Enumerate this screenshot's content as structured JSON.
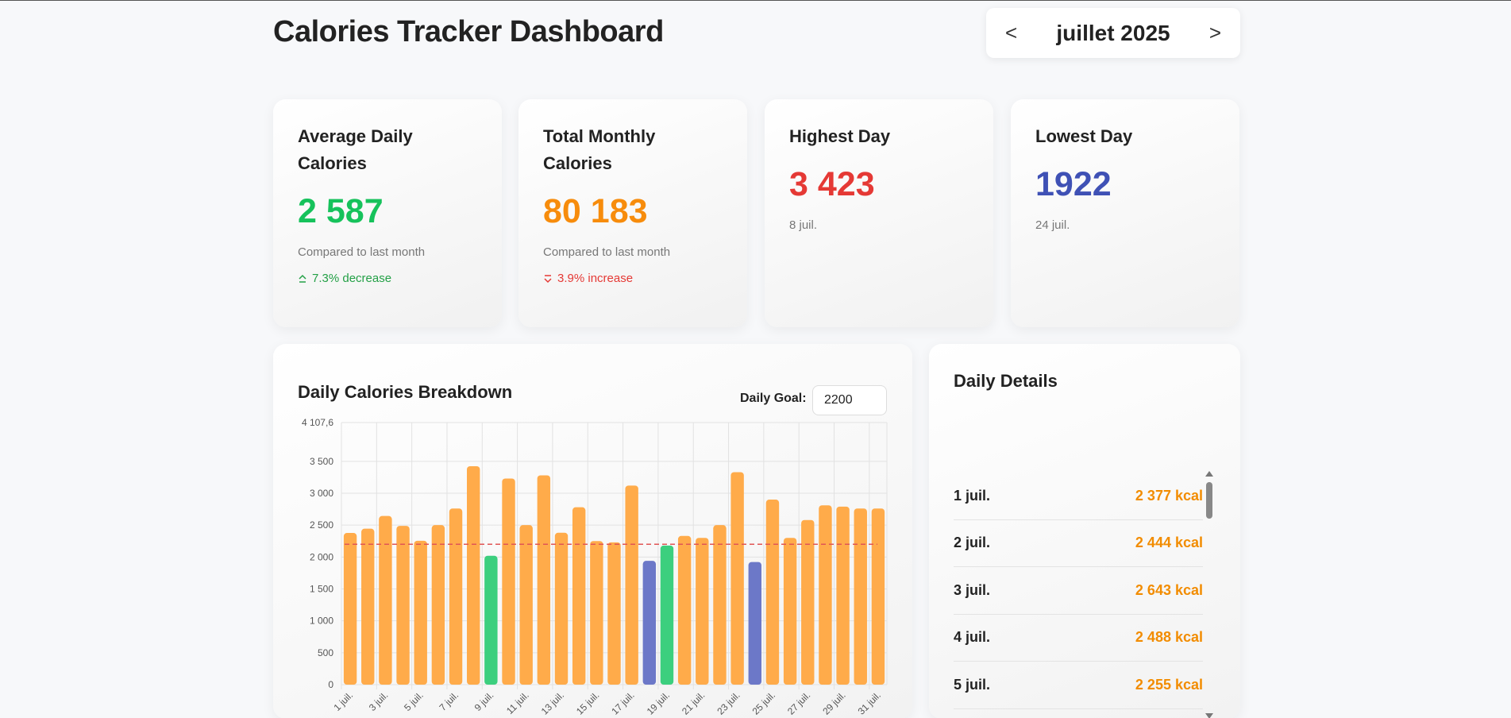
{
  "header": {
    "title": "Calories Tracker Dashboard"
  },
  "month_picker": {
    "prev": "<",
    "label": "juillet 2025",
    "next": ">"
  },
  "cards": [
    {
      "title": "Average Daily Calories",
      "value": "2 587",
      "value_color": "#16c25b",
      "sub": "Compared to last month",
      "change": "7.3% decrease",
      "change_color": "#23a046"
    },
    {
      "title": "Total Monthly Calories",
      "value": "80 183",
      "value_color": "#f78c0c",
      "sub": "Compared to last month",
      "change": "3.9% increase",
      "change_color": "#e53935"
    },
    {
      "title": "Highest Day",
      "value": "3 423",
      "value_color": "#e53935",
      "sub": "8 juil."
    },
    {
      "title": "Lowest Day",
      "value": "1922",
      "value_color": "#3f51b5",
      "sub": "24 juil."
    }
  ],
  "chart_panel": {
    "title": "Daily Calories Breakdown",
    "goal_label": "Daily Goal:",
    "goal_value": "2200"
  },
  "chart_data": {
    "type": "bar",
    "categories": [
      "1 juil.",
      "2 juil.",
      "3 juil.",
      "4 juil.",
      "5 juil.",
      "6 juil.",
      "7 juil.",
      "8 juil.",
      "9 juil.",
      "10 juil.",
      "11 juil.",
      "12 juil.",
      "13 juil.",
      "14 juil.",
      "15 juil.",
      "16 juil.",
      "17 juil.",
      "18 juil.",
      "19 juil.",
      "20 juil.",
      "21 juil.",
      "22 juil.",
      "23 juil.",
      "24 juil.",
      "25 juil.",
      "26 juil.",
      "27 juil.",
      "28 juil.",
      "29 juil.",
      "30 juil.",
      "31 juil."
    ],
    "x_tick_labels": [
      "1 juil.",
      "3 juil.",
      "5 juil.",
      "7 juil.",
      "9 juil.",
      "11 juil.",
      "13 juil.",
      "15 juil.",
      "17 juil.",
      "19 juil.",
      "21 juil.",
      "23 juil.",
      "25 juil.",
      "27 juil.",
      "29 juil.",
      "31 juil."
    ],
    "values": [
      2377,
      2444,
      2643,
      2488,
      2255,
      2500,
      2760,
      3423,
      2020,
      3230,
      2500,
      3280,
      2380,
      2780,
      2250,
      2230,
      3120,
      1940,
      2180,
      2330,
      2300,
      2500,
      3330,
      1922,
      2900,
      2300,
      2580,
      2810,
      2790,
      2760,
      2760
    ],
    "bar_colors": [
      "over",
      "over",
      "over",
      "over",
      "over",
      "over",
      "over",
      "over",
      "under",
      "over",
      "over",
      "over",
      "over",
      "over",
      "over",
      "over",
      "over",
      "low",
      "under",
      "over",
      "over",
      "over",
      "over",
      "low",
      "over",
      "over",
      "over",
      "over",
      "over",
      "over",
      "over"
    ],
    "palette": {
      "over": "#ffab4a",
      "under": "#3ccf7e",
      "low": "#6c78c8",
      "goal": "#e05555"
    },
    "goal": 2200,
    "ylim": [
      0,
      4107.6
    ],
    "y_ticks": [
      0,
      500,
      1000,
      1500,
      2000,
      2500,
      3000,
      3500,
      4107.6
    ],
    "y_tick_labels": [
      "0",
      "500",
      "1 000",
      "1 500",
      "2 000",
      "2 500",
      "3 000",
      "3 500",
      "4 107,6"
    ],
    "grid": true
  },
  "details_panel": {
    "title": "Daily Details",
    "rows": [
      {
        "date": "1 juil.",
        "kcal": "2 377 kcal"
      },
      {
        "date": "2 juil.",
        "kcal": "2 444 kcal"
      },
      {
        "date": "3 juil.",
        "kcal": "2 643 kcal"
      },
      {
        "date": "4 juil.",
        "kcal": "2 488 kcal"
      },
      {
        "date": "5 juil.",
        "kcal": "2 255 kcal"
      }
    ]
  }
}
